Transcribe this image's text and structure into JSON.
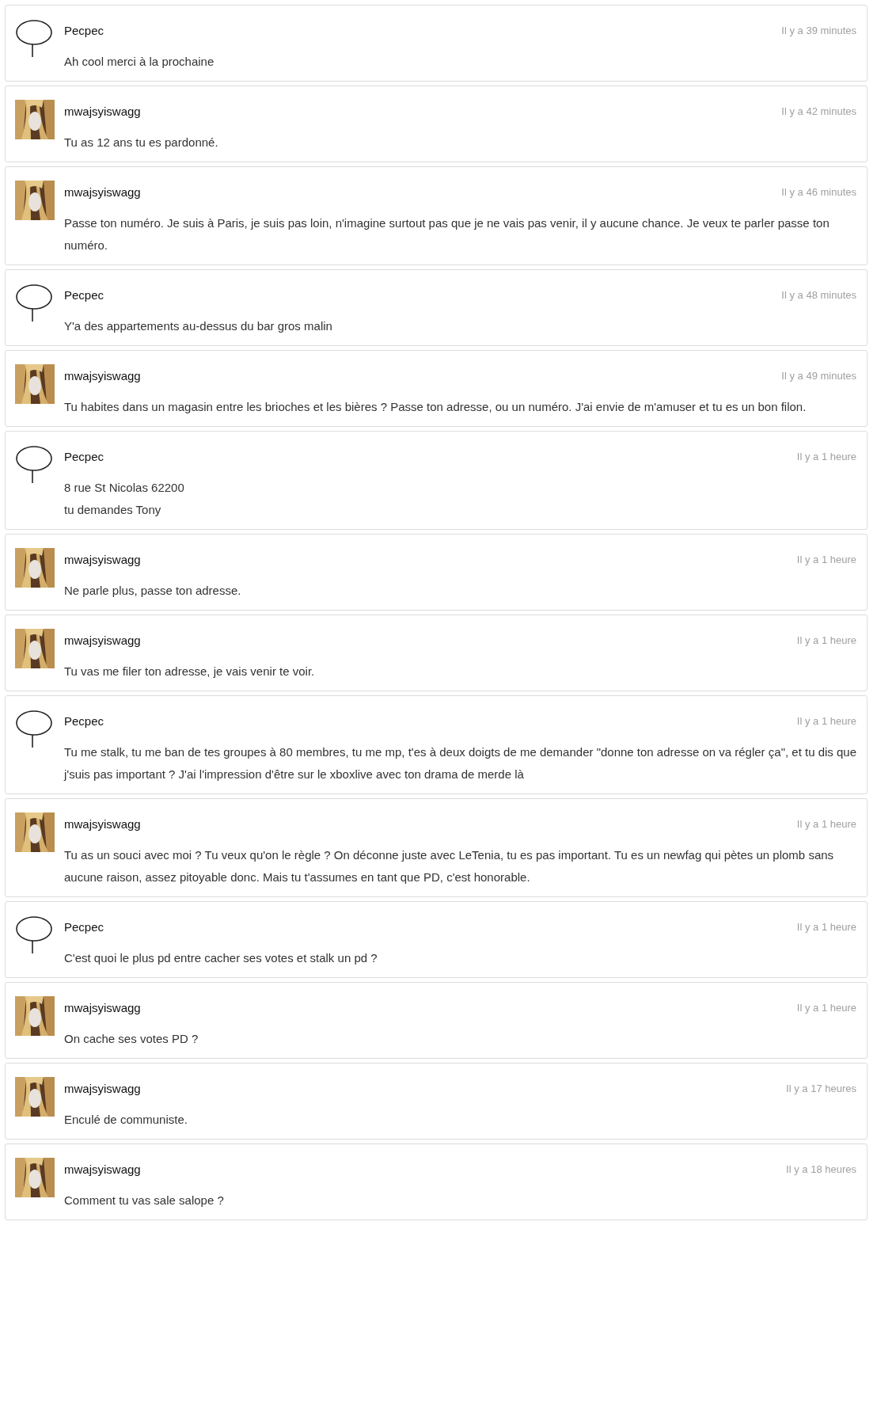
{
  "comments": [
    {
      "author": "Pecpec",
      "avatar": {
        "kind": "sketch"
      },
      "time": "Il y a 39 minutes",
      "text": "Ah cool merci à la prochaine"
    },
    {
      "author": "mwajsyiswagg",
      "time": "Il y a 42 minutes",
      "text": "Tu as 12 ans tu es pardonné."
    },
    {
      "author": "mwajsyiswagg",
      "time": "Il y a 46 minutes",
      "text": "Passe ton numéro. Je suis à Paris, je suis pas loin, n'imagine surtout pas que je ne vais pas venir, il y aucune chance. Je veux te parler passe ton numéro."
    },
    {
      "author": "Pecpec",
      "avatar": {
        "kind": "sketch"
      },
      "time": "Il y a 48 minutes",
      "text": "Y'a des appartements au-dessus du bar gros malin"
    },
    {
      "author": "mwajsyiswagg",
      "time": "Il y a 49 minutes",
      "text": "Tu habites dans un magasin entre les brioches et les bières ? Passe ton adresse, ou un numéro. J'ai envie de m'amuser et tu es un bon filon."
    },
    {
      "author": "Pecpec",
      "avatar": {
        "kind": "sketch"
      },
      "time": "Il y a 1 heure",
      "text": "8 rue St Nicolas 62200\ntu demandes Tony"
    },
    {
      "author": "mwajsyiswagg",
      "time": "Il y a 1 heure",
      "text": "Ne parle plus, passe ton adresse."
    },
    {
      "author": "mwajsyiswagg",
      "time": "Il y a 1 heure",
      "text": "Tu vas me filer ton adresse, je vais venir te voir."
    },
    {
      "author": "Pecpec",
      "avatar": {
        "kind": "sketch"
      },
      "time": "Il y a 1 heure",
      "text": "Tu me stalk, tu me ban de tes groupes à 80 membres, tu me mp, t'es à deux doigts de me demander \"donne ton adresse on va régler ça\", et tu dis que j'suis pas important ? J'ai l'impression d'être sur le xboxlive avec ton drama de merde là"
    },
    {
      "author": "mwajsyiswagg",
      "time": "Il y a 1 heure",
      "text": "Tu as un souci avec moi ? Tu veux qu'on le règle ? On déconne juste avec LeTenia, tu es pas important. Tu es un newfag qui pètes un plomb sans aucune raison, assez pitoyable donc. Mais tu t'assumes en tant que PD, c'est honorable."
    },
    {
      "author": "Pecpec",
      "avatar": {
        "kind": "sketch"
      },
      "time": "Il y a 1 heure",
      "text": "C'est quoi le plus pd entre cacher ses votes et stalk un pd ?"
    },
    {
      "author": "mwajsyiswagg",
      "time": "Il y a 1 heure",
      "text": "On cache ses votes PD ?"
    },
    {
      "author": "mwajsyiswagg",
      "time": "Il y a 17 heures",
      "text": "Enculé de communiste."
    },
    {
      "author": "mwajsyiswagg",
      "time": "Il y a 18 heures",
      "text": "Comment tu vas sale salope ?"
    }
  ]
}
